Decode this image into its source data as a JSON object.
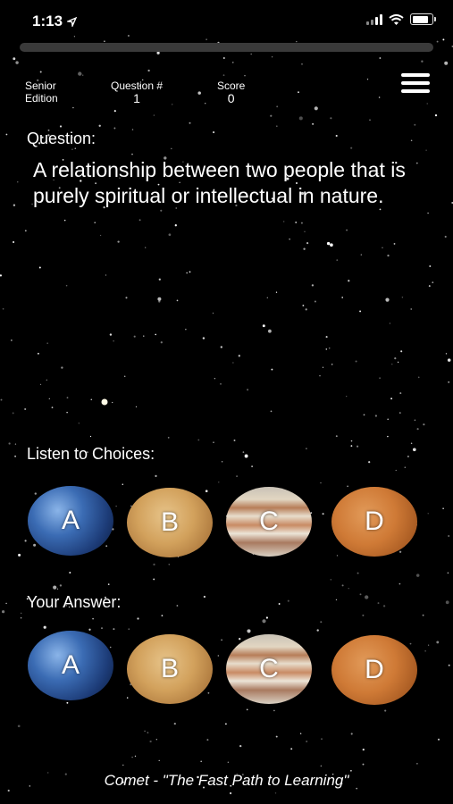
{
  "status": {
    "time": "1:13"
  },
  "header": {
    "edition_line1": "Senior",
    "edition_line2": "Edition",
    "question_label": "Question #",
    "question_number": "1",
    "score_label": "Score",
    "score_value": "0"
  },
  "question": {
    "label": "Question:",
    "text": "A relationship between two people that is purely spiritual or intellectual in nature."
  },
  "listen": {
    "label": "Listen to Choices:",
    "choices": [
      "A",
      "B",
      "C",
      "D"
    ]
  },
  "answer": {
    "label": "Your Answer:",
    "choices": [
      "A",
      "B",
      "C",
      "D"
    ]
  },
  "footer": {
    "text": "Comet - \"The Fast Path to Learning\""
  },
  "icons": [
    "location-arrow-icon",
    "signal-icon",
    "wifi-icon",
    "battery-icon",
    "menu-icon"
  ],
  "colors": {
    "background": "#000000",
    "text": "#ffffff"
  }
}
